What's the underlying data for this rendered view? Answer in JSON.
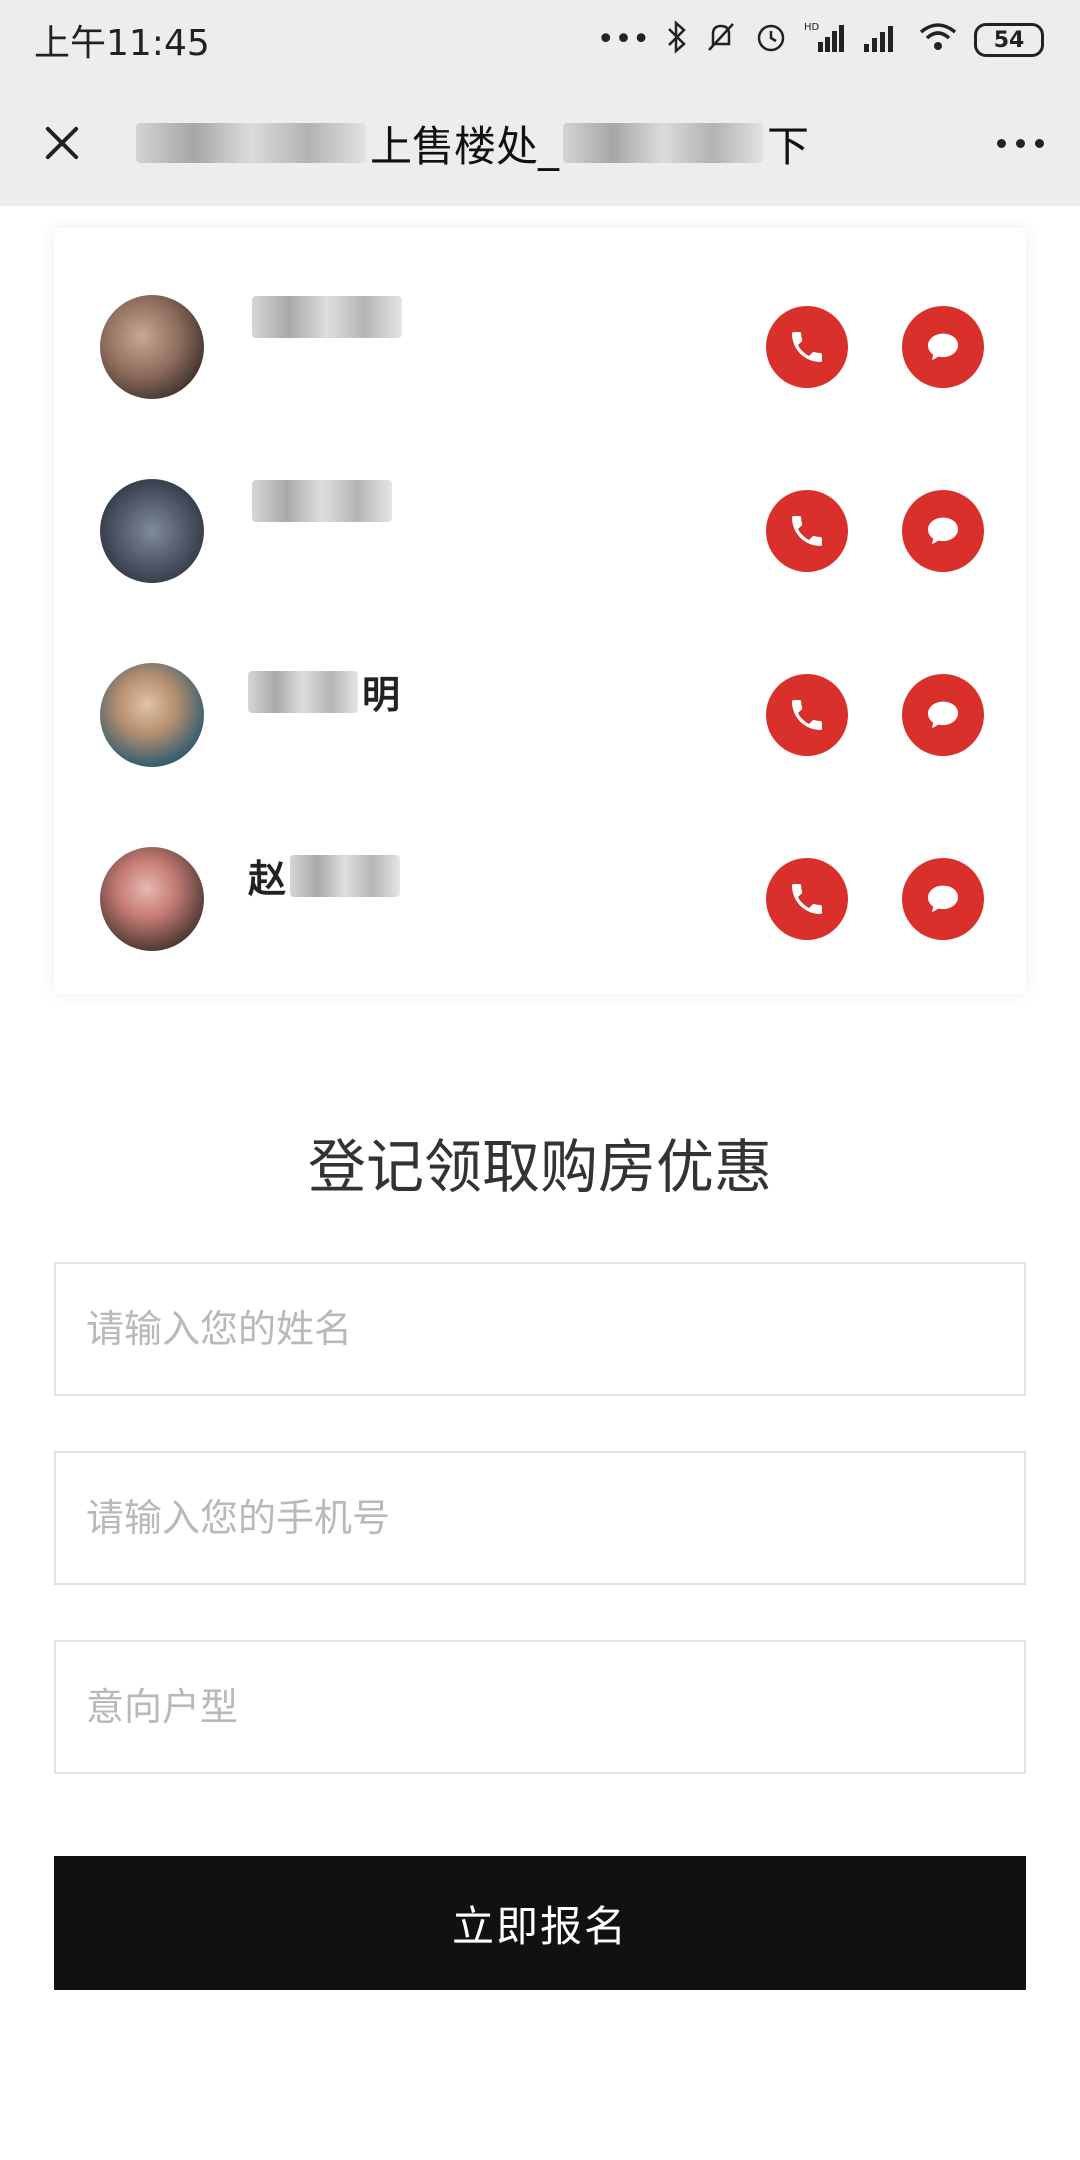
{
  "status_bar": {
    "time": "上午11:45",
    "icons": [
      "more-dots-icon",
      "bluetooth-icon",
      "mute-icon",
      "alarm-icon",
      "hd-signal-icon",
      "signal-icon",
      "wifi-icon"
    ],
    "battery": "54"
  },
  "title_bar": {
    "title_parts": [
      "上售楼处_",
      "下"
    ]
  },
  "agents": [
    {
      "name": ""
    },
    {
      "name": ""
    },
    {
      "name": "明"
    },
    {
      "name": "赵"
    }
  ],
  "form": {
    "title": "登记领取购房优惠",
    "name_placeholder": "请输入您的姓名",
    "phone_placeholder": "请输入您的手机号",
    "unit_placeholder": "意向户型",
    "submit_label": "立即报名"
  },
  "colors": {
    "accent_red": "#d9302b",
    "button_black": "#111111",
    "header_bg": "#ededed"
  }
}
